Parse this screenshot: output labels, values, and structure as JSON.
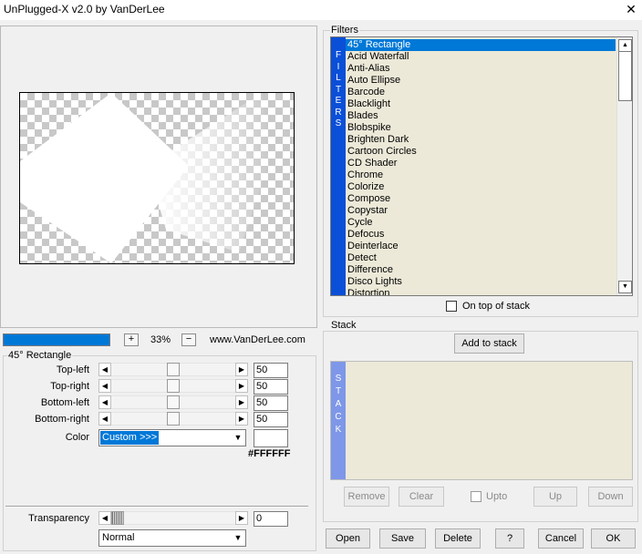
{
  "window": {
    "title": "UnPlugged-X v2.0 by VanDerLee",
    "close_glyph": "✕"
  },
  "zoom": {
    "progress": 1.0,
    "plus": "+",
    "level": "33%",
    "minus": "−",
    "website": "www.VanDerLee.com"
  },
  "params": {
    "group_title": "45° Rectangle",
    "sliders": [
      {
        "label": "Top-left",
        "value": "50",
        "fraction": 0.5
      },
      {
        "label": "Top-right",
        "value": "50",
        "fraction": 0.5
      },
      {
        "label": "Bottom-left",
        "value": "50",
        "fraction": 0.5
      },
      {
        "label": "Bottom-right",
        "value": "50",
        "fraction": 0.5
      }
    ],
    "color_label": "Color",
    "color_selected": "Custom >>>",
    "color_hex": "#FFFFFF",
    "transparency_label": "Transparency",
    "transparency_value": "0",
    "transparency_fraction": 0.0,
    "blend_mode": "Normal"
  },
  "filters": {
    "group_title": "Filters",
    "strip_letters": [
      "F",
      "I",
      "L",
      "T",
      "E",
      "R",
      "S"
    ],
    "items": [
      "45° Rectangle",
      "Acid Waterfall",
      "Anti-Alias",
      "Auto Ellipse",
      "Barcode",
      "Blacklight",
      "Blades",
      "Blobspike",
      "Brighten Dark",
      "Cartoon Circles",
      "CD Shader",
      "Chrome",
      "Colorize",
      "Compose",
      "Copystar",
      "Cycle",
      "Defocus",
      "Deinterlace",
      "Detect",
      "Difference",
      "Disco Lights",
      "Distortion"
    ],
    "selected_index": 0,
    "on_top_label": "On top of stack",
    "on_top_checked": false
  },
  "stack": {
    "group_title": "Stack",
    "add_label": "Add to stack",
    "strip_letters": [
      "S",
      "T",
      "A",
      "C",
      "K"
    ],
    "remove_label": "Remove",
    "clear_label": "Clear",
    "upto_label": "Upto",
    "up_label": "Up",
    "down_label": "Down"
  },
  "buttons": {
    "open": "Open",
    "save": "Save",
    "delete": "Delete",
    "help": "?",
    "cancel": "Cancel",
    "ok": "OK"
  },
  "colors": {
    "accent": "#0078d7",
    "filter_strip": "#0a4fd8",
    "stack_strip": "#7e97e8",
    "list_bg": "#ece9d8"
  }
}
